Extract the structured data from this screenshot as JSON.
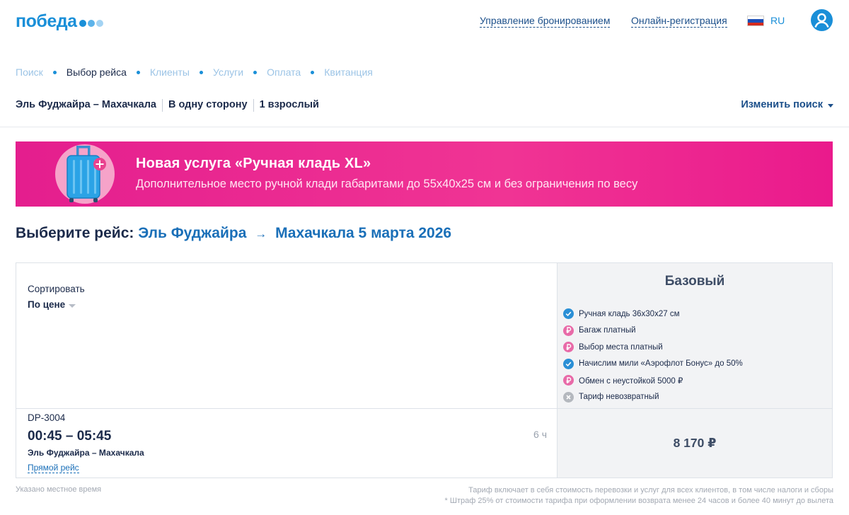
{
  "header": {
    "logo_text": "победа",
    "logo_dot_colors": [
      "#1a8fd8",
      "#5cb3ea",
      "#a3d3f3"
    ],
    "manage_booking": "Управление бронированием",
    "online_checkin": "Онлайн-регистрация",
    "language": "RU",
    "flag_icon": "russia-flag-icon",
    "user_icon": "user-account-icon"
  },
  "steps": [
    {
      "label": "Поиск",
      "active": false
    },
    {
      "label": "Выбор рейса",
      "active": true
    },
    {
      "label": "Клиенты",
      "active": false
    },
    {
      "label": "Услуги",
      "active": false
    },
    {
      "label": "Оплата",
      "active": false
    },
    {
      "label": "Квитанция",
      "active": false
    }
  ],
  "summary": {
    "route": "Эль Фуджайра – Махачкала",
    "trip_type": "В одну сторону",
    "passengers": "1 взрослый",
    "change_search": "Изменить поиск"
  },
  "banner": {
    "title": "Новая услуга «Ручная кладь XL»",
    "subtitle": "Дополнительное место ручной клади габаритами до 55х40х25 см и без ограничения по весу",
    "icon": "suitcase-plus-icon"
  },
  "heading": {
    "prefix": "Выберите рейс:",
    "from": "Эль Фуджайра",
    "arrow": "→",
    "to_date": "Махачкала 5 марта 2026"
  },
  "sort": {
    "label": "Сортировать",
    "value": "По цене"
  },
  "fare": {
    "name": "Базовый",
    "features": [
      {
        "text": "Ручная кладь 36х30х27 см",
        "icon": "check-icon",
        "color": "#2a8fd6"
      },
      {
        "text": "Багаж платный",
        "icon": "ruble-icon",
        "color": "#e86aa8"
      },
      {
        "text": "Выбор места платный",
        "icon": "ruble-icon",
        "color": "#e86aa8"
      },
      {
        "text": "Начислим мили «Аэрофлот Бонус» до 50%",
        "icon": "check-icon",
        "color": "#2a8fd6"
      },
      {
        "text": "Обмен с неустойкой 5000 ₽",
        "icon": "ruble-icon",
        "color": "#e86aa8"
      },
      {
        "text": "Тариф невозвратный",
        "icon": "cross-icon",
        "color": "#b4b8be"
      }
    ]
  },
  "flight": {
    "number": "DP-3004",
    "time": "00:45 – 05:45",
    "route": "Эль Фуджайра – Махачкала",
    "type": "Прямой рейс",
    "duration": "6 ч",
    "price": "8 170 ₽"
  },
  "notes": {
    "local_time": "Указано местное время",
    "tariff_includes": "Тариф включает в себя стоимость перевозки и услуг для всех клиентов, в том числе налоги и сборы",
    "penalty": "* Штраф 25% от стоимости тарифа при оформлении возврата менее 24 часов и более 40 минут до вылета"
  },
  "colors": {
    "brand_blue": "#1a8fd8",
    "banner_pink": "#ea1a8c",
    "dark_text": "#1b2a4a"
  }
}
